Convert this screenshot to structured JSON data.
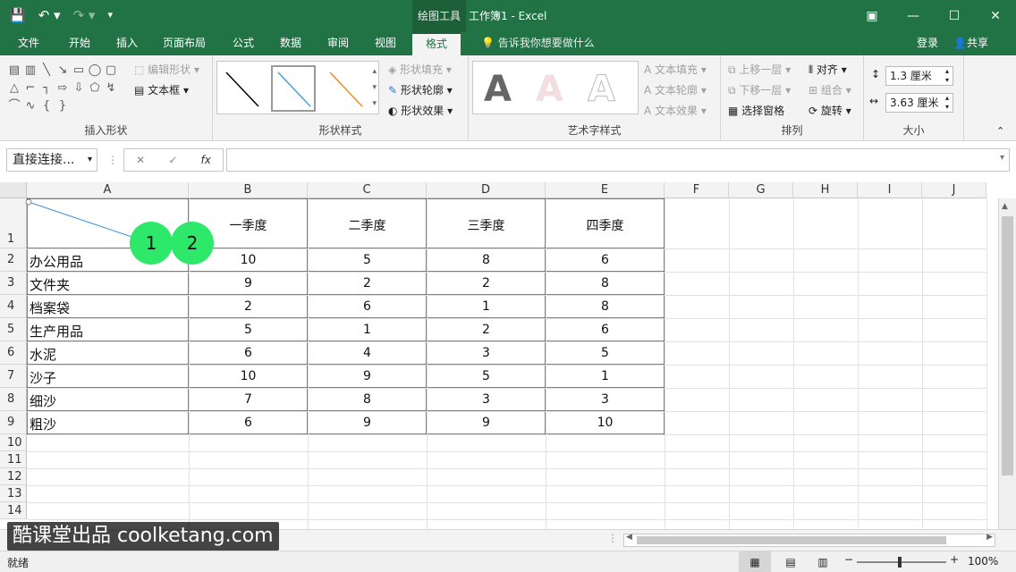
{
  "titlebar": {
    "context_tab": "绘图工具",
    "title": "工作簿1 - Excel",
    "qat": [
      "save-icon",
      "undo-icon",
      "redo-icon",
      "customize-icon"
    ],
    "window_controls": [
      "ribbon-display-icon",
      "minimize-icon",
      "maximize-icon",
      "close-icon"
    ]
  },
  "tabs": {
    "items": [
      "文件",
      "开始",
      "插入",
      "页面布局",
      "公式",
      "数据",
      "审阅",
      "视图",
      "格式"
    ],
    "active": "格式",
    "tell_me": "告诉我你想要做什么",
    "login": "登录",
    "share": "共享"
  },
  "ribbon": {
    "insert_shapes": {
      "label": "插入形状",
      "edit_shape": "编辑形状",
      "text_box": "文本框",
      "shape_glyphs": [
        "▤",
        "▥",
        "╲",
        "↘",
        "▭",
        "◯",
        "▢",
        "△",
        "⌐",
        "┐",
        "⇨",
        "⇩",
        "⬠",
        "↯",
        "⌒",
        "∿",
        "{",
        "}"
      ]
    },
    "shape_styles": {
      "label": "形状样式",
      "fill": "形状填充",
      "outline": "形状轮廓",
      "effects": "形状效果",
      "thumb_colors": [
        "#000000",
        "#4a9fd8",
        "#ed8b2f"
      ]
    },
    "wordart": {
      "label": "艺术字样式",
      "text_fill": "文本填充",
      "text_outline": "文本轮廓",
      "text_effects": "文本效果",
      "sample": "A"
    },
    "arrange": {
      "label": "排列",
      "bring_forward": "上移一层",
      "send_backward": "下移一层",
      "selection_pane": "选择窗格",
      "align": "对齐",
      "group": "组合",
      "rotate": "旋转"
    },
    "size": {
      "label": "大小",
      "height": "1.3 厘米",
      "width": "3.63 厘米"
    }
  },
  "formula_bar": {
    "name_box": "直接连接...",
    "fx": "fx",
    "cancel": "✕",
    "enter": "✓",
    "value": ""
  },
  "sheet": {
    "columns": [
      "A",
      "B",
      "C",
      "D",
      "E",
      "F",
      "G",
      "H",
      "I",
      "J"
    ],
    "rows": [
      "1",
      "2",
      "3",
      "4",
      "5",
      "6",
      "7",
      "8",
      "9",
      "10",
      "11",
      "12",
      "13",
      "14"
    ],
    "headers": [
      "一季度",
      "二季度",
      "三季度",
      "四季度"
    ],
    "data": [
      {
        "name": "办公用品",
        "q": [
          "10",
          "5",
          "8",
          "6"
        ]
      },
      {
        "name": "文件夹",
        "q": [
          "9",
          "2",
          "2",
          "8"
        ]
      },
      {
        "name": "档案袋",
        "q": [
          "2",
          "6",
          "1",
          "8"
        ]
      },
      {
        "name": "生产用品",
        "q": [
          "5",
          "1",
          "2",
          "6"
        ]
      },
      {
        "name": "水泥",
        "q": [
          "6",
          "4",
          "3",
          "5"
        ]
      },
      {
        "name": "沙子",
        "q": [
          "10",
          "9",
          "5",
          "1"
        ]
      },
      {
        "name": "细沙",
        "q": [
          "7",
          "8",
          "3",
          "3"
        ]
      },
      {
        "name": "粗沙",
        "q": [
          "6",
          "9",
          "9",
          "10"
        ]
      }
    ]
  },
  "badges": [
    "1",
    "2"
  ],
  "watermark": "酷课堂出品 coolketang.com",
  "status": {
    "ready": "就绪",
    "zoom": "100%",
    "views": [
      "normal-view-icon",
      "page-layout-icon",
      "page-break-icon"
    ]
  },
  "colors": {
    "excel_green": "#217346",
    "badge_green": "#2ee86a"
  }
}
